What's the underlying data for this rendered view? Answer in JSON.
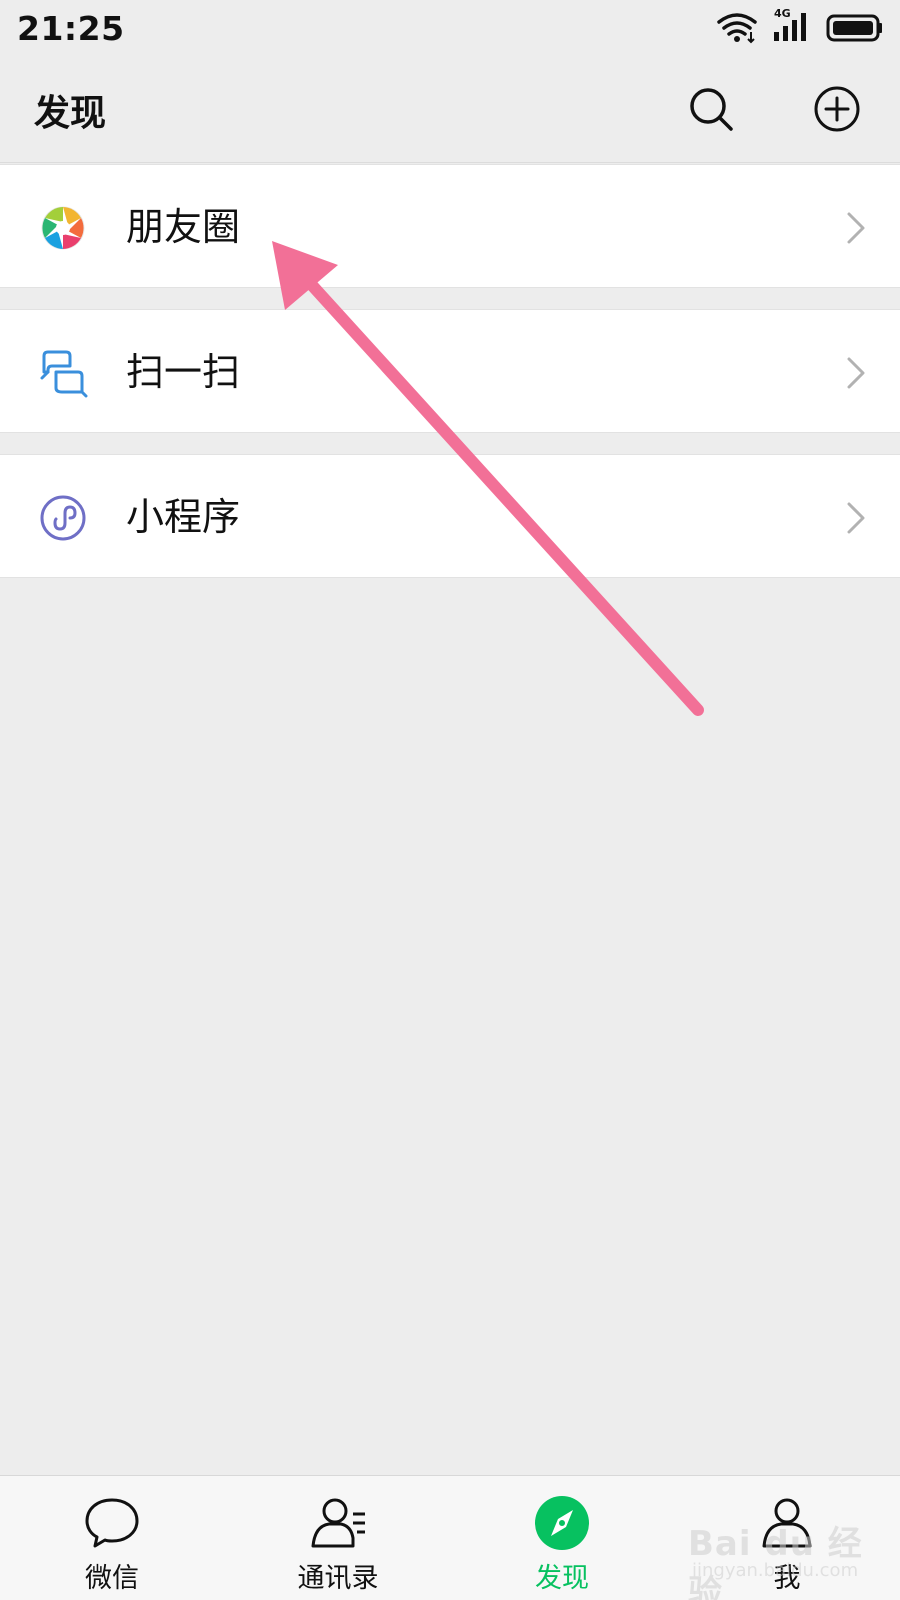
{
  "status_bar": {
    "time": "21:25",
    "network_label": "4G",
    "icons": [
      "wifi-icon",
      "cellular-signal-icon",
      "battery-icon"
    ]
  },
  "header": {
    "title": "发现",
    "actions": [
      "search-icon",
      "add-circle-icon"
    ]
  },
  "menu": {
    "items": [
      {
        "label": "朋友圈",
        "icon": "moments-aperture-icon"
      },
      {
        "label": "扫一扫",
        "icon": "scan-icon"
      },
      {
        "label": "小程序",
        "icon": "mini-program-icon"
      }
    ]
  },
  "tab_bar": {
    "tabs": [
      {
        "label": "微信",
        "icon": "chat-bubble-icon"
      },
      {
        "label": "通讯录",
        "icon": "contacts-icon"
      },
      {
        "label": "发现",
        "icon": "compass-icon",
        "active": true
      },
      {
        "label": "我",
        "icon": "person-icon"
      }
    ]
  },
  "watermark": {
    "brand": "Bai du 经验",
    "url": "jingyan.baidu.com"
  },
  "colors": {
    "accent": "#07c160",
    "background": "#ededed",
    "annotation_arrow": "#f27097",
    "mini_program": "#6f6fc6",
    "scan": "#3a8fdc"
  }
}
